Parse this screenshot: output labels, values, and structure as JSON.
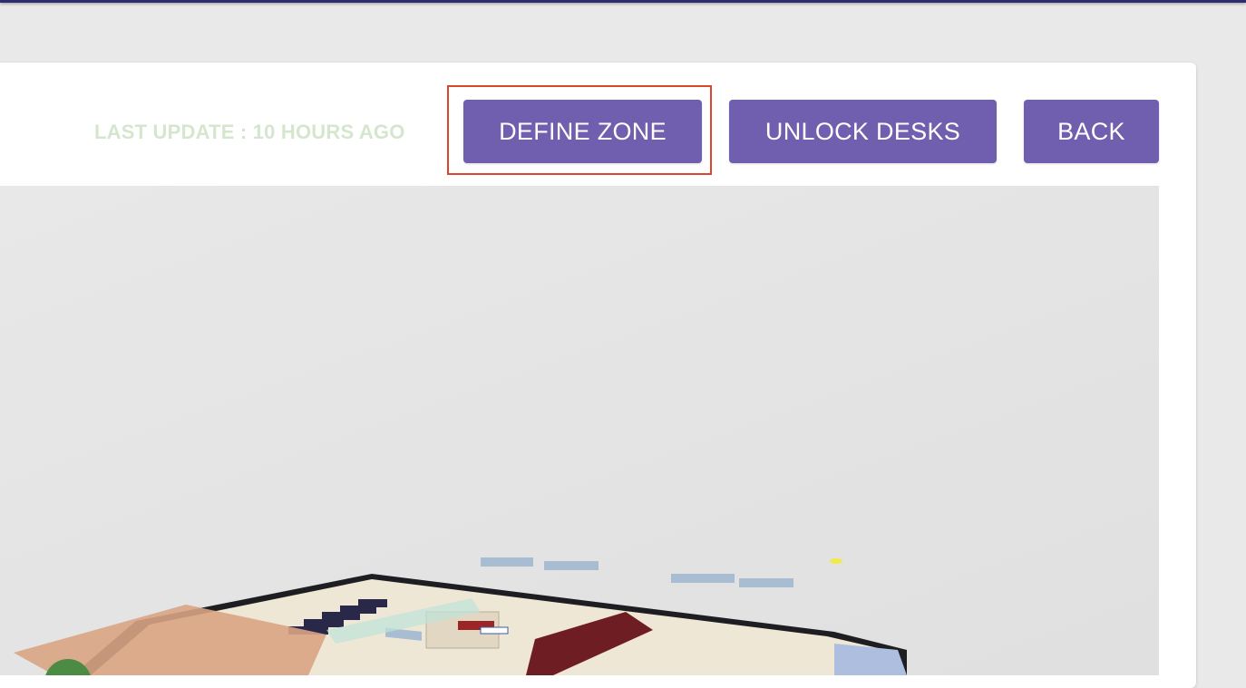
{
  "header": {
    "last_update": "LAST UPDATE : 10 HOURS AGO"
  },
  "toolbar": {
    "define_zone_label": "DEFINE ZONE",
    "unlock_desks_label": "UNLOCK DESKS",
    "back_label": "BACK"
  },
  "colors": {
    "accent": "#6f5fae",
    "highlight": "#d9462a",
    "last_update_text": "#d5e6cf",
    "top_bar": "#2b2d6e"
  }
}
